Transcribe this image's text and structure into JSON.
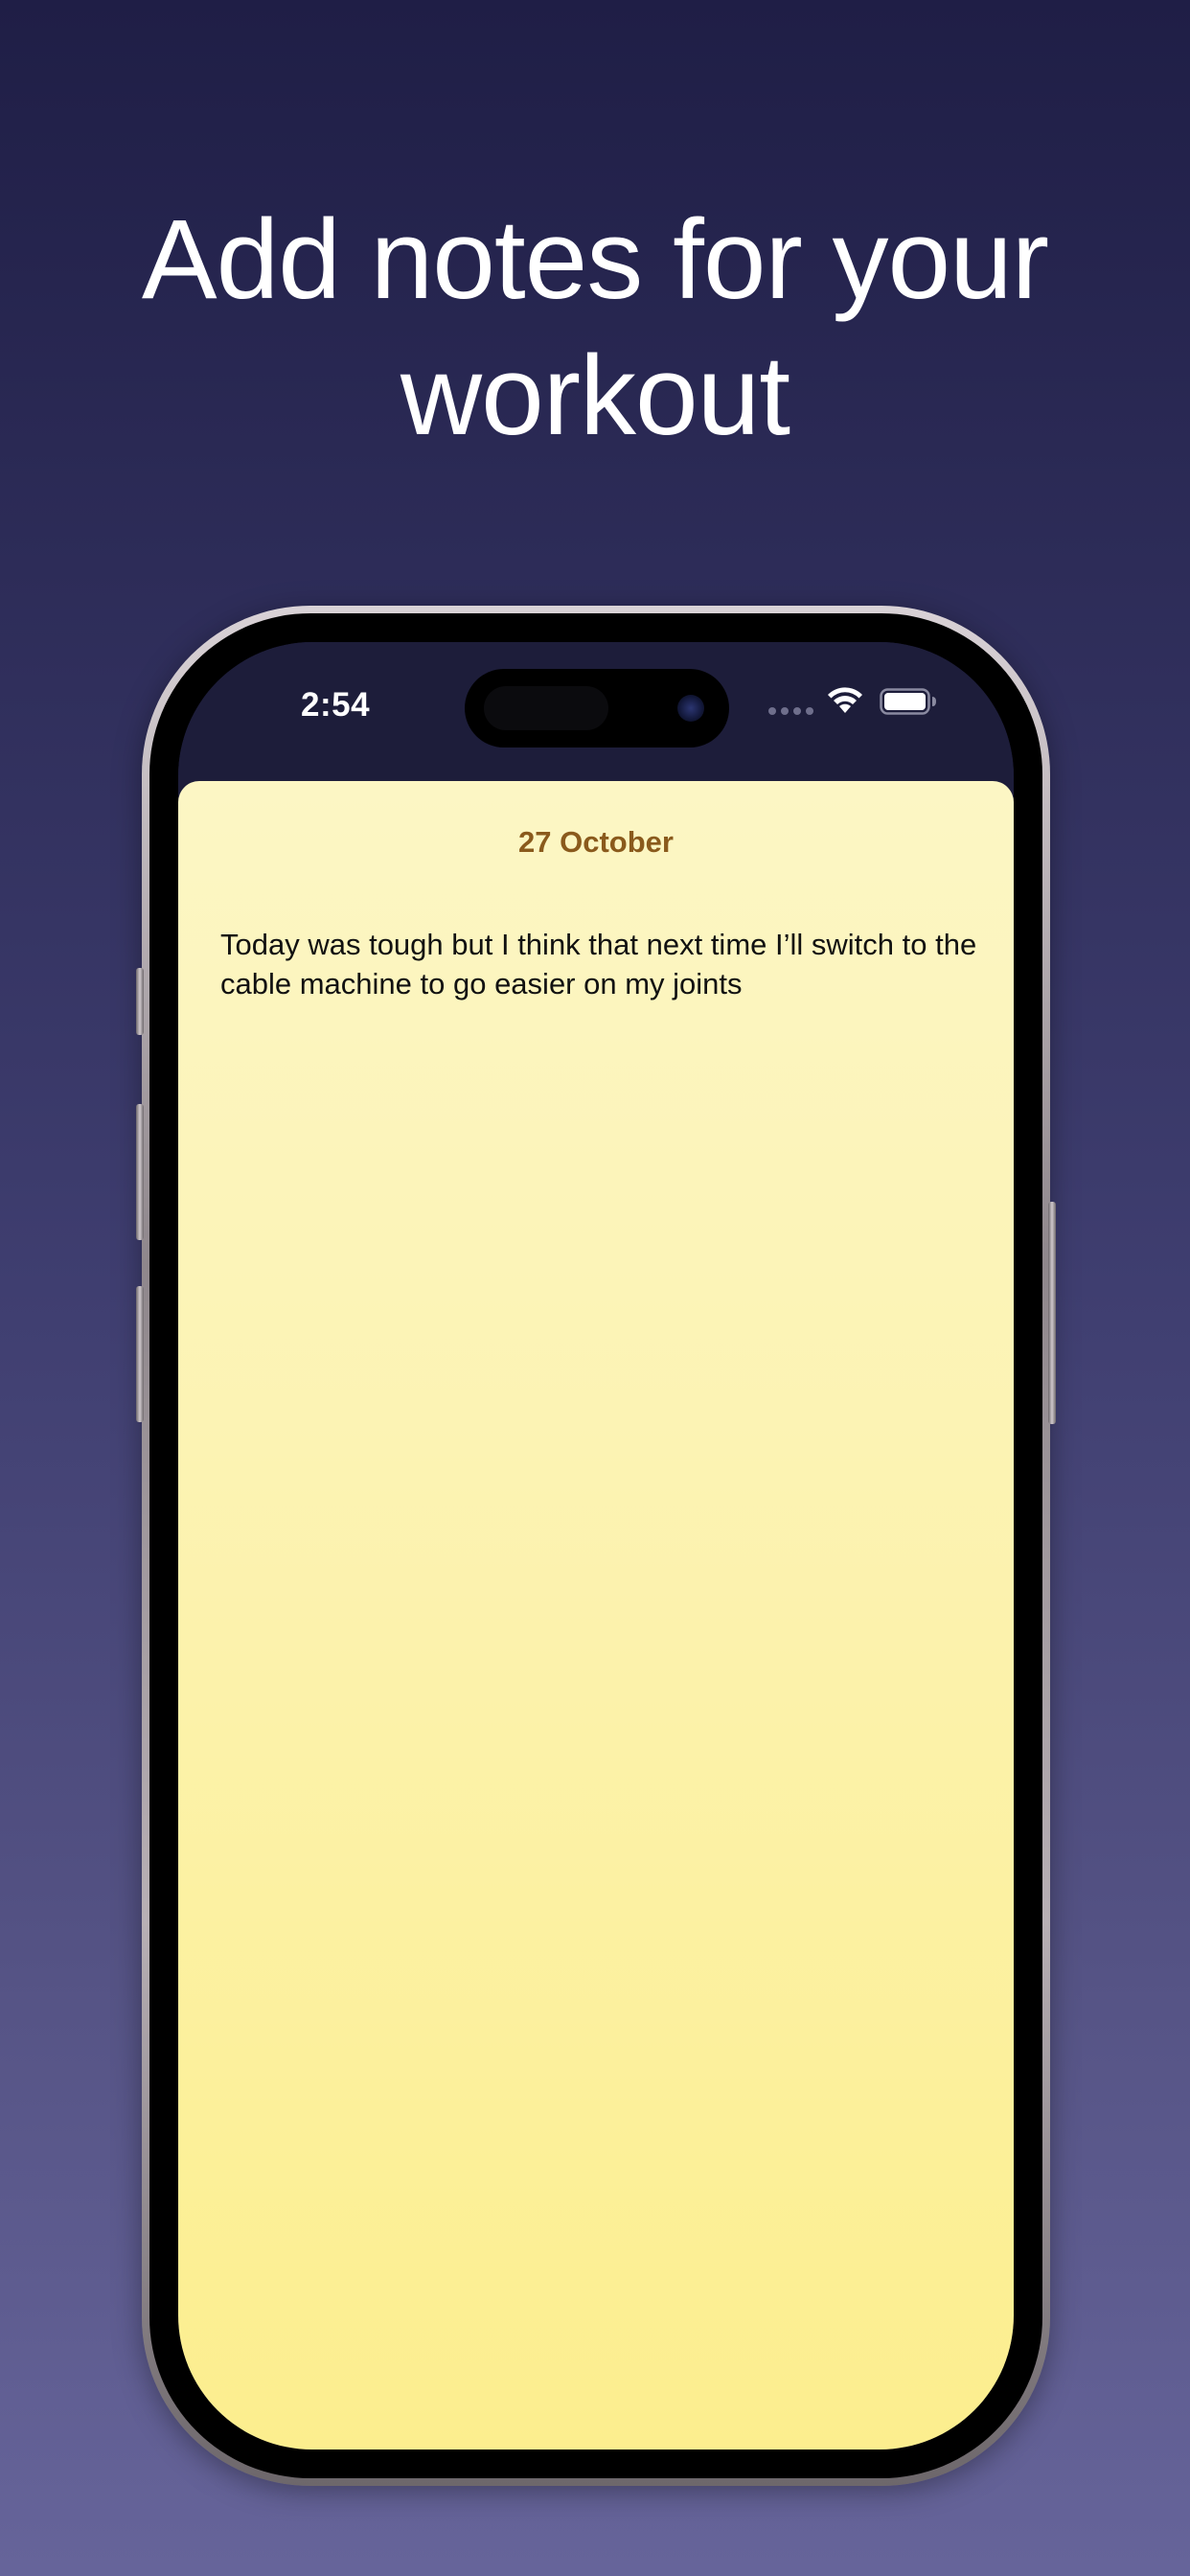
{
  "headline": {
    "line1": "Add notes for your",
    "line2": "workout"
  },
  "status_bar": {
    "time": "2:54",
    "icons": [
      "cellular-signal-icon",
      "wifi-icon",
      "battery-icon"
    ]
  },
  "note": {
    "date": "27 October",
    "text": "Today was tough but I think that next time I’ll switch to the cable machine to go easier on my joints"
  },
  "colors": {
    "background_top": "#1f1e46",
    "background_bottom": "#66649a",
    "note_background": "#fcf3b3",
    "date_accent": "#8a5a1c"
  }
}
